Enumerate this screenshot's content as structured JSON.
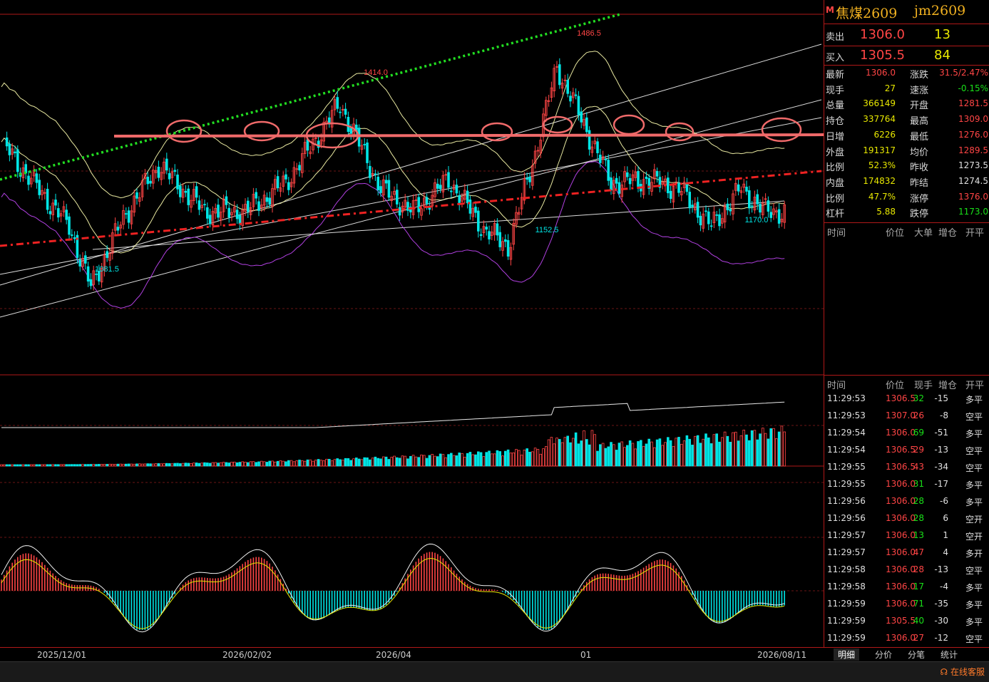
{
  "header": {
    "badge": "M",
    "name": "焦煤2609",
    "code": "jm2609"
  },
  "quote": {
    "ask_label": "卖出",
    "ask_price": "1306.0",
    "ask_vol": "13",
    "bid_label": "买入",
    "bid_price": "1305.5",
    "bid_vol": "84"
  },
  "stats": [
    {
      "l1": "最新",
      "v1": "1306.0",
      "c1": "red",
      "l2": "涨跌",
      "v2": "31.5/2.47%",
      "c2": "red"
    },
    {
      "l1": "现手",
      "v1": "27",
      "c1": "yellow",
      "l2": "速涨",
      "v2": "-0.15%",
      "c2": "green"
    },
    {
      "l1": "总量",
      "v1": "366149",
      "c1": "yellow",
      "l2": "开盘",
      "v2": "1281.5",
      "c2": "red"
    },
    {
      "l1": "持仓",
      "v1": "337764",
      "c1": "yellow",
      "l2": "最高",
      "v2": "1309.0",
      "c2": "red"
    },
    {
      "l1": "日增",
      "v1": "6226",
      "c1": "yellow",
      "l2": "最低",
      "v2": "1276.0",
      "c2": "red"
    },
    {
      "l1": "外盘",
      "v1": "191317",
      "c1": "yellow",
      "l2": "均价",
      "v2": "1289.5",
      "c2": "red"
    },
    {
      "l1": "比例",
      "v1": "52.3%",
      "c1": "yellow",
      "l2": "昨收",
      "v2": "1273.5",
      "c2": "white"
    },
    {
      "l1": "内盘",
      "v1": "174832",
      "c1": "yellow",
      "l2": "昨结",
      "v2": "1274.5",
      "c2": "white"
    },
    {
      "l1": "比例",
      "v1": "47.7%",
      "c1": "yellow",
      "l2": "涨停",
      "v2": "1376.0",
      "c2": "red"
    },
    {
      "l1": "杠杆",
      "v1": "5.88",
      "c1": "yellow",
      "l2": "跌停",
      "v2": "1173.0",
      "c2": "green"
    }
  ],
  "panel1_header": [
    "时间",
    "价位",
    "大单",
    "增仓",
    "开平"
  ],
  "ticks_header": [
    "时间",
    "价位",
    "现手",
    "增仓",
    "开平"
  ],
  "ticks": [
    {
      "t": "11:29:53",
      "p": "1306.5",
      "pc": "red",
      "v": "32",
      "vc": "green",
      "d": "-15",
      "o": "多平"
    },
    {
      "t": "11:29:53",
      "p": "1307.0",
      "pc": "red",
      "v": "26",
      "vc": "red",
      "d": "-8",
      "o": "空平"
    },
    {
      "t": "11:29:54",
      "p": "1306.0",
      "pc": "red",
      "v": "69",
      "vc": "green",
      "d": "-51",
      "o": "多平"
    },
    {
      "t": "11:29:54",
      "p": "1306.5",
      "pc": "red",
      "v": "29",
      "vc": "red",
      "d": "-13",
      "o": "空平"
    },
    {
      "t": "11:29:55",
      "p": "1306.5",
      "pc": "red",
      "v": "43",
      "vc": "red",
      "d": "-34",
      "o": "空平"
    },
    {
      "t": "11:29:55",
      "p": "1306.0",
      "pc": "red",
      "v": "31",
      "vc": "green",
      "d": "-17",
      "o": "多平"
    },
    {
      "t": "11:29:56",
      "p": "1306.0",
      "pc": "red",
      "v": "28",
      "vc": "green",
      "d": "-6",
      "o": "多平"
    },
    {
      "t": "11:29:56",
      "p": "1306.0",
      "pc": "red",
      "v": "28",
      "vc": "green",
      "d": "6",
      "o": "空开"
    },
    {
      "t": "11:29:57",
      "p": "1306.0",
      "pc": "red",
      "v": "13",
      "vc": "green",
      "d": "1",
      "o": "空开"
    },
    {
      "t": "11:29:57",
      "p": "1306.0",
      "pc": "red",
      "v": "47",
      "vc": "red",
      "d": "4",
      "o": "多开"
    },
    {
      "t": "11:29:58",
      "p": "1306.0",
      "pc": "red",
      "v": "28",
      "vc": "red",
      "d": "-13",
      "o": "空平"
    },
    {
      "t": "11:29:58",
      "p": "1306.0",
      "pc": "red",
      "v": "17",
      "vc": "green",
      "d": "-4",
      "o": "多平"
    },
    {
      "t": "11:29:59",
      "p": "1306.0",
      "pc": "red",
      "v": "71",
      "vc": "green",
      "d": "-35",
      "o": "多平"
    },
    {
      "t": "11:29:59",
      "p": "1305.5",
      "pc": "red",
      "v": "40",
      "vc": "green",
      "d": "-30",
      "o": "多平"
    },
    {
      "t": "11:29:59",
      "p": "1306.0",
      "pc": "red",
      "v": "27",
      "vc": "red",
      "d": "-12",
      "o": "空平"
    }
  ],
  "tabs": [
    "明细",
    "分价",
    "分笔",
    "统计"
  ],
  "service": "在线客服",
  "colors": {
    "up": "#ff4545",
    "down": "#00e5e5",
    "frame": "#b01818",
    "ma": "#e8e8e8",
    "boll": "#e8e8a0",
    "lower": "#b040e0"
  },
  "chart_data": {
    "type": "candlestick",
    "x_ticks": [
      "2025/12/01",
      "2026/02/02",
      "2026/04",
      "01",
      "2026/08/11"
    ],
    "price_labels": [
      "1486.5",
      "1414.0",
      "1081.5",
      "1152.5",
      "1170.0"
    ],
    "ylim": [
      940,
      1560
    ],
    "anchors": [
      [
        0,
        1340
      ],
      [
        10,
        1280
      ],
      [
        25,
        1195
      ],
      [
        33,
        1090
      ],
      [
        45,
        1210
      ],
      [
        58,
        1300
      ],
      [
        75,
        1220
      ],
      [
        90,
        1220
      ],
      [
        105,
        1270
      ],
      [
        125,
        1405
      ],
      [
        140,
        1260
      ],
      [
        152,
        1220
      ],
      [
        165,
        1275
      ],
      [
        178,
        1190
      ],
      [
        187,
        1160
      ],
      [
        197,
        1320
      ],
      [
        205,
        1470
      ],
      [
        212,
        1400
      ],
      [
        225,
        1270
      ],
      [
        238,
        1275
      ],
      [
        250,
        1260
      ],
      [
        262,
        1195
      ],
      [
        273,
        1260
      ],
      [
        282,
        1220
      ]
    ],
    "volume_note": "bars + open interest line",
    "macd_note": "DIF/DEA with histogram"
  }
}
